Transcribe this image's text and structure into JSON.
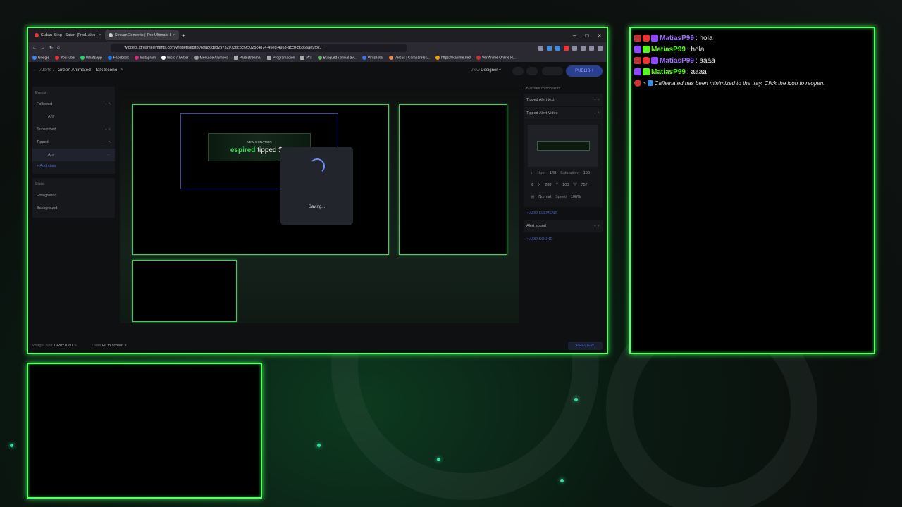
{
  "browser": {
    "tabs": [
      {
        "label": "Cuban Bling - Satan (Prod. Alvo Locos",
        "close": "×"
      },
      {
        "label": "StreamElements | The Ultimate S",
        "close": "×"
      }
    ],
    "new_tab": "+",
    "window_buttons": [
      "–",
      "□",
      "×"
    ],
    "url": "widgets.streamelements.com/widgets/editor/69a86deb29732073dcbcf9c/025c4874-45ed-4953-acc0-56865ae9f8c7",
    "bookmarks": [
      "Google",
      "YouTube",
      "WhatsApp",
      "Facebook",
      "Instagram",
      "Inicio / Twitter",
      "Menú de Alumnos",
      "Para streamar",
      "Programación",
      "IA's",
      "Búsqueda oficial av...",
      "VirusTotal",
      "Versus | Compárelos...",
      "https://jkanime.net/",
      "Ver Anime Online H..."
    ]
  },
  "editor": {
    "breadcrumb_root": "Alerts",
    "breadcrumb_sep": "/",
    "title": "Green Animated - Talk Scene",
    "view_label": "View",
    "view_value": "Designer",
    "publish_label": "PUBLISH",
    "events_header": "Events",
    "events": [
      {
        "label": "Followed",
        "children": [
          "Any"
        ]
      },
      {
        "label": "Subscribed",
        "children": []
      },
      {
        "label": "Tipped",
        "children": [
          "Any"
        ]
      }
    ],
    "add_state": "+ Add state",
    "static_header": "Static",
    "static_items": [
      "Foreground",
      "Background"
    ],
    "canvas": {
      "banner_top": "NEW DONATION",
      "banner_name": "espired",
      "banner_rest": "tipped $1!",
      "saving": "Saving..."
    },
    "components_header": "On-screen components",
    "components": [
      "Tipped Alert text",
      "Tipped Alert Video"
    ],
    "props": {
      "hue_label": "Hue:",
      "hue": "148",
      "sat_label": "Saturation:",
      "sat": "100",
      "x_label": "X",
      "x": "288",
      "y_label": "Y",
      "y": "100",
      "w_label": "W",
      "w": "757",
      "blend": "Normal",
      "speed_label": "Speed",
      "speed": "100%"
    },
    "add_element": "+ ADD ELEMENT",
    "alert_sound": "Alert sound",
    "add_sound": "+ ADD SOUND",
    "widget_size_label": "Widget size",
    "widget_size": "1920x1080",
    "zoom_label": "Zoom",
    "zoom_value": "Fit to screen",
    "preview": "PREVIEW"
  },
  "chat": [
    {
      "platform": "twitch",
      "user": "MatiasP99",
      "text": ": hola"
    },
    {
      "platform": "kick",
      "user": "MatiasP99",
      "text": ": hola"
    },
    {
      "platform": "twitch",
      "user": "MatiasP99",
      "text": ": aaaa"
    },
    {
      "platform": "kick",
      "user": "MatiasP99",
      "text": ": aaaa"
    }
  ],
  "chat_system": "Caffeinated has been minimized to the tray. Click the icon to reopen.",
  "colors": {
    "neon": "#5cff6a",
    "twitch": "#9147ff",
    "kick": "#53fc18",
    "accent": "#2a3f8f"
  }
}
